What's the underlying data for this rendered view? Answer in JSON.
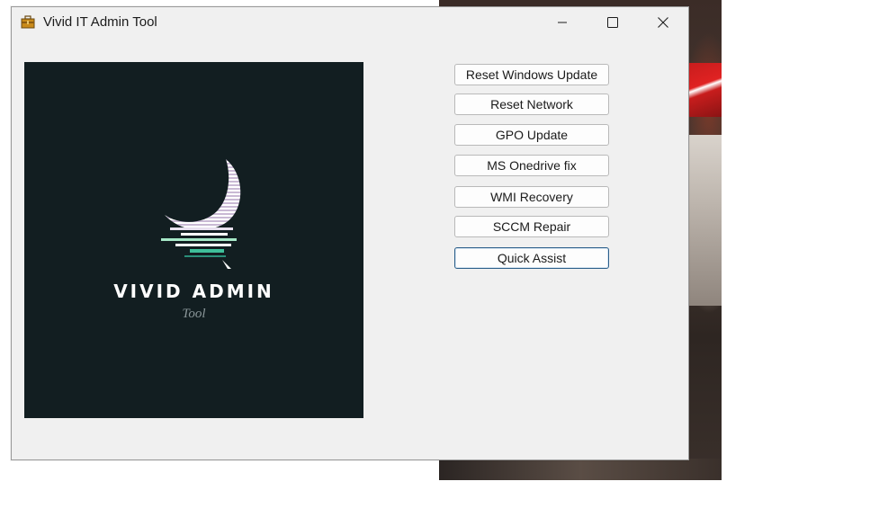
{
  "window": {
    "title": "Vivid IT Admin Tool",
    "icon": "toolbox-icon"
  },
  "caption_buttons": {
    "minimize": "minimize-icon",
    "maximize": "maximize-icon",
    "close": "close-icon"
  },
  "logo": {
    "title": "VIVID ADMIN",
    "subtitle": "Tool",
    "background_color": "#121e21"
  },
  "actions": [
    {
      "label": "Reset Windows Update"
    },
    {
      "label": "Reset Network"
    },
    {
      "label": "GPO Update"
    },
    {
      "label": "MS Onedrive fix"
    },
    {
      "label": "WMI Recovery"
    },
    {
      "label": "SCCM Repair"
    },
    {
      "label": "Quick Assist",
      "focused": true
    }
  ],
  "colors": {
    "window_bg": "#f0f0f0",
    "focus_border": "#2c5f8a"
  }
}
